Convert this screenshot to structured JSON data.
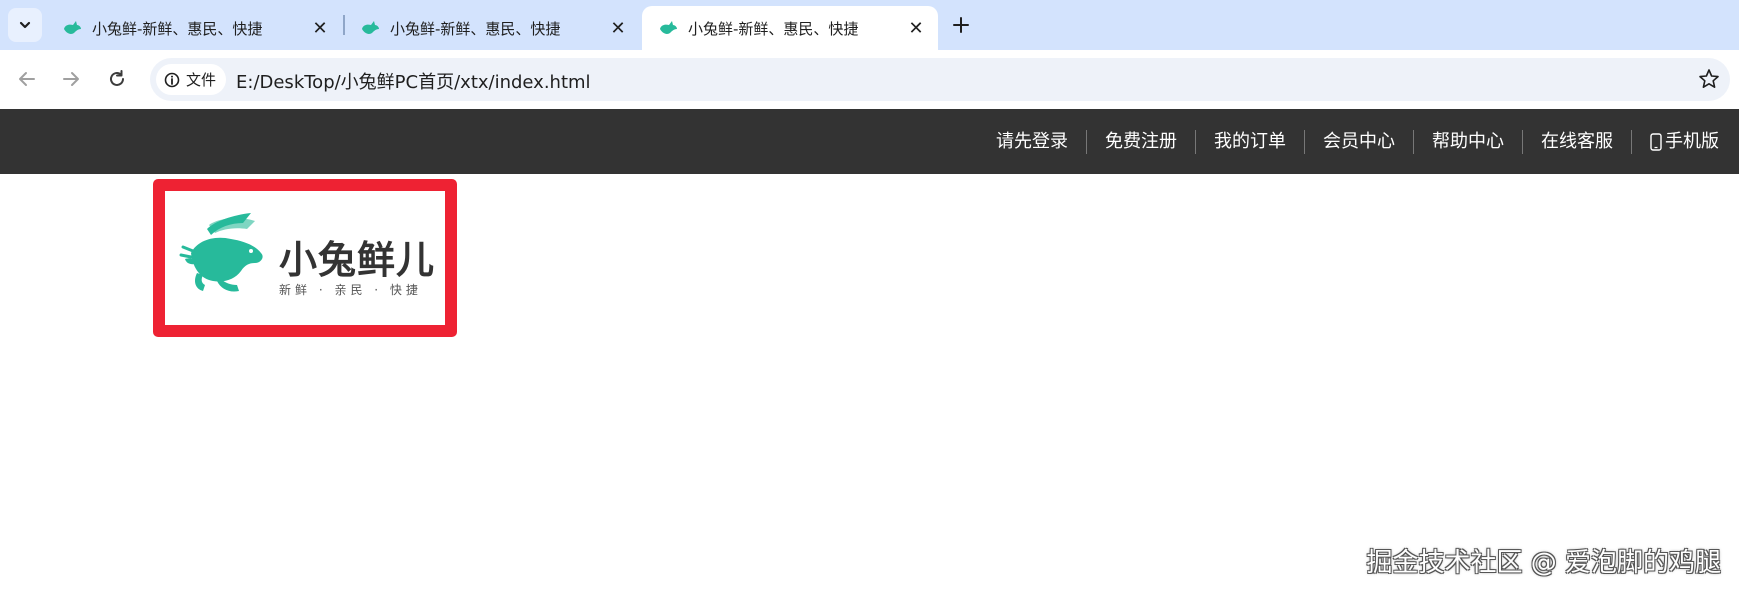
{
  "browser": {
    "tabs": [
      {
        "title": "小兔鲜-新鲜、惠民、快捷",
        "active": false
      },
      {
        "title": "小兔鲜-新鲜、惠民、快捷",
        "active": false
      },
      {
        "title": "小兔鲜-新鲜、惠民、快捷",
        "active": true
      }
    ],
    "address": {
      "security_label": "文件",
      "url": "E:/DeskTop/小兔鲜PC首页/xtx/index.html"
    }
  },
  "page": {
    "shortcut_links": [
      "请先登录",
      "免费注册",
      "我的订单",
      "会员中心",
      "帮助中心",
      "在线客服",
      "手机版"
    ],
    "logo": {
      "name": "小兔鲜儿",
      "tagline": "新鲜 · 亲民 · 快捷",
      "brand_color": "#27ba9b",
      "highlight_border_color": "#ee2233"
    },
    "watermark": "掘金技术社区 @ 爱泡脚的鸡腿"
  },
  "colors": {
    "tabstrip_bg": "#d3e3fd",
    "shortcut_bg": "#333333"
  }
}
